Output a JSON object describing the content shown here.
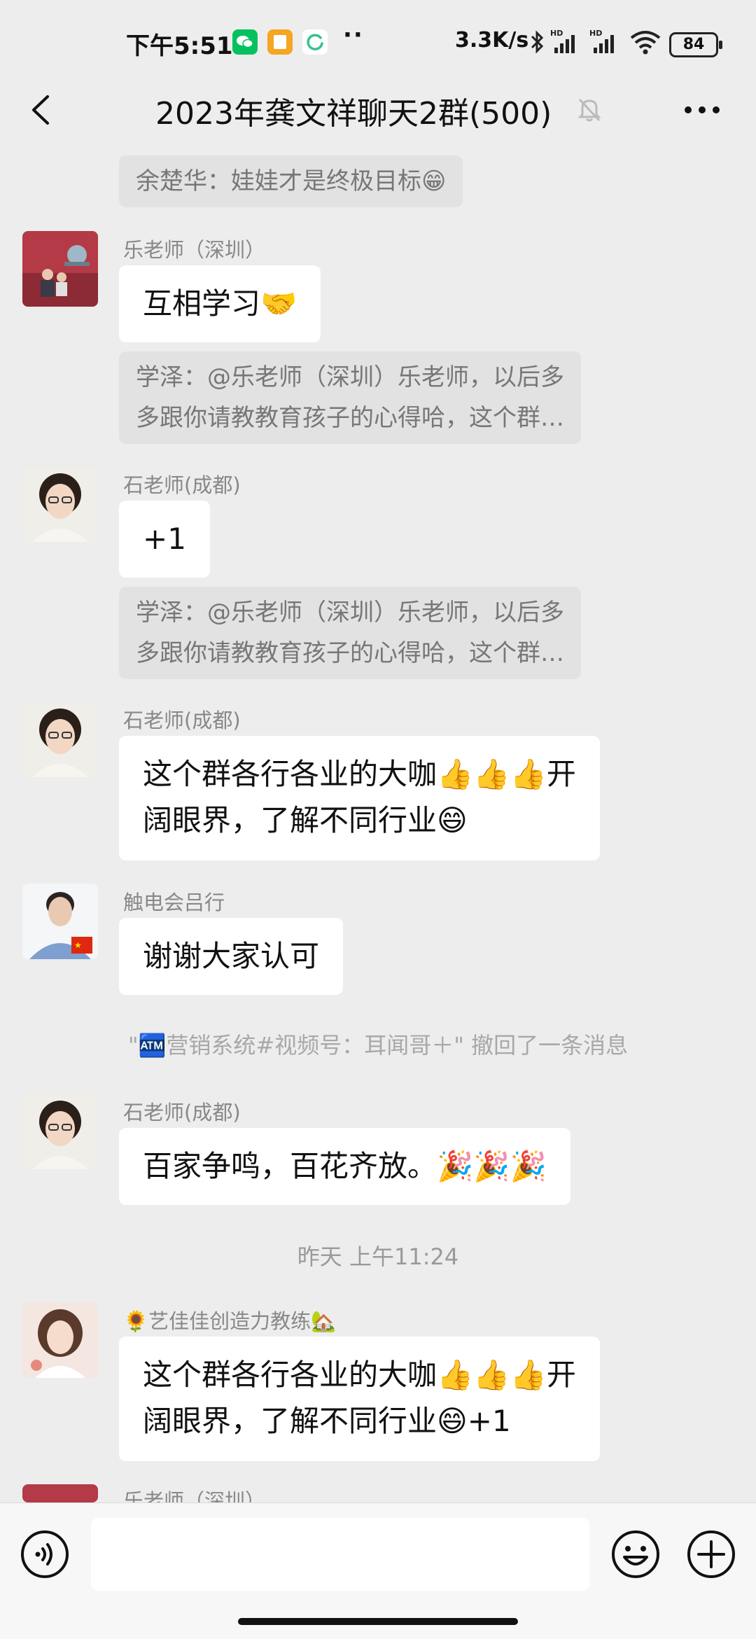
{
  "status_bar": {
    "time": "下午5:51",
    "dots": "··",
    "net_speed": "3.3K/s",
    "battery": "84",
    "colors": {
      "wechat": "#07c160",
      "app2": "#f5a623",
      "app3": "#32c38c"
    }
  },
  "header": {
    "title": "2023年龚文祥聊天2群(500)",
    "back_icon": "chevron-left-icon",
    "mute_icon": "bell-off-icon",
    "more_icon": "more-dots-icon"
  },
  "messages": {
    "m0": {
      "quote": "余楚华：娃娃才是终极目标😁"
    },
    "m1": {
      "sender": "乐老师（深圳）",
      "text": "互相学习🤝",
      "quote_line1": "学泽：@乐老师（深圳）乐老师，以后多",
      "quote_line2": "多跟你请教教育孩子的心得哈，这个群…"
    },
    "m2": {
      "sender": "石老师(成都)",
      "text": "+1",
      "quote_line1": "学泽：@乐老师（深圳）乐老师，以后多",
      "quote_line2": "多跟你请教教育孩子的心得哈，这个群…"
    },
    "m3": {
      "sender": "石老师(成都)",
      "line1": "这个群各行各业的大咖👍👍👍开",
      "line2": "阔眼界，了解不同行业😄"
    },
    "m4": {
      "sender": "触电会吕行",
      "text": "谢谢大家认可"
    },
    "recall_note": "\"🏧营销系统#视频号：耳闻哥＋\" 撤回了一条消息",
    "m5": {
      "sender": "石老师(成都)",
      "text": "百家争鸣，百花齐放。🎉🎉🎉"
    },
    "timestamp": "昨天 上午11:24",
    "m6": {
      "sender": "🌻艺佳佳创造力教练🏡",
      "line1": "这个群各行各业的大咖👍👍👍开",
      "line2": "阔眼界，了解不同行业😄+1"
    },
    "m7": {
      "sender": "乐老师（深圳）"
    }
  },
  "input_bar": {
    "voice_icon": "voice-icon",
    "placeholder": "",
    "emoji_icon": "smiley-icon",
    "plus_icon": "plus-circle-icon"
  }
}
